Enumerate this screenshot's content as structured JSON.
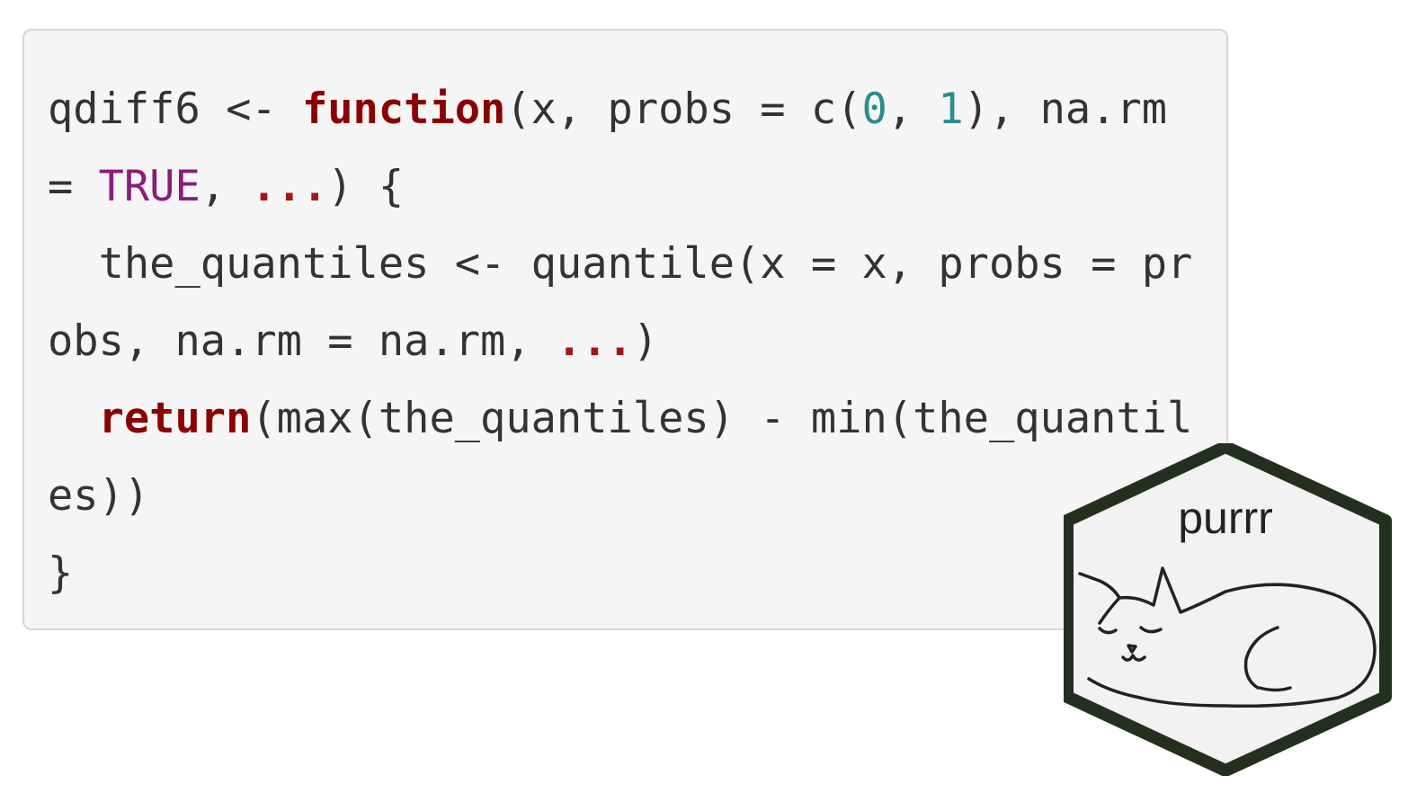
{
  "code": {
    "lines": [
      [
        {
          "t": "qdiff6 <- ",
          "c": "plain"
        },
        {
          "t": "function",
          "c": "kw"
        },
        {
          "t": "(x, probs = c(",
          "c": "plain"
        },
        {
          "t": "0",
          "c": "num"
        },
        {
          "t": ", ",
          "c": "plain"
        },
        {
          "t": "1",
          "c": "num"
        },
        {
          "t": "), na.rm",
          "c": "plain"
        }
      ],
      [
        {
          "t": "= ",
          "c": "plain"
        },
        {
          "t": "TRUE",
          "c": "const"
        },
        {
          "t": ", ",
          "c": "plain"
        },
        {
          "t": "...",
          "c": "dots"
        },
        {
          "t": ") {",
          "c": "plain"
        }
      ],
      [
        {
          "t": "  the_quantiles <- quantile(x = x, probs = pr",
          "c": "plain"
        }
      ],
      [
        {
          "t": "obs, na.rm = na.rm, ",
          "c": "plain"
        },
        {
          "t": "...",
          "c": "dots"
        },
        {
          "t": ")",
          "c": "plain"
        }
      ],
      [
        {
          "t": "  ",
          "c": "plain"
        },
        {
          "t": "return",
          "c": "kw"
        },
        {
          "t": "(max(the_quantiles) - min(the_quantil",
          "c": "plain"
        }
      ],
      [
        {
          "t": "es))",
          "c": "plain"
        }
      ],
      [
        {
          "t": "}",
          "c": "plain"
        }
      ]
    ]
  },
  "sticker": {
    "title": "purrr",
    "icon": "sleeping-cat-icon",
    "colors": {
      "border": "#24301f",
      "fill": "#f2f2f2",
      "ink": "#222222"
    }
  },
  "colors": {
    "code_background": "#f5f5f5",
    "code_border": "#d6d6d6",
    "keyword": "#8b0000",
    "constant": "#8a1c7c",
    "number": "#2a8c8c",
    "ellipsis": "#a31515",
    "text": "#333333"
  }
}
